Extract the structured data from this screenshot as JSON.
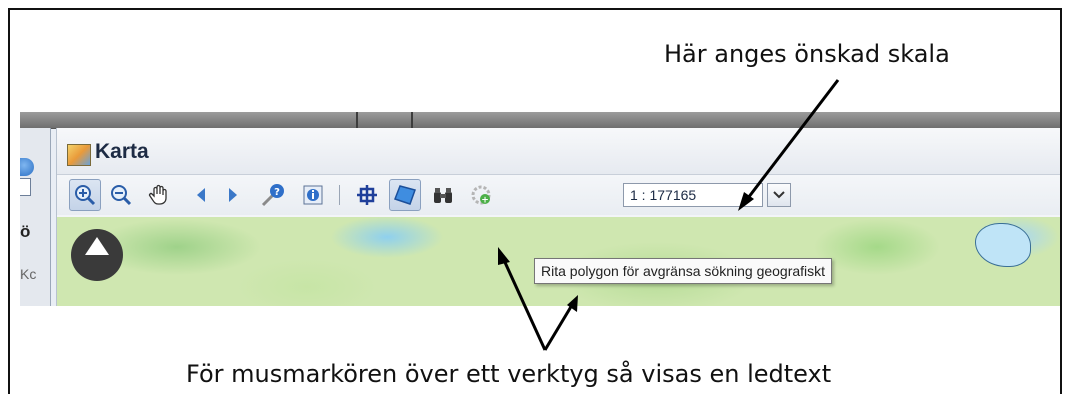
{
  "annotations": {
    "top_callout": "Här anges önskad skala",
    "bottom_callout": "För musmarkören över ett verktyg så visas en ledtext"
  },
  "panel": {
    "title": "Karta",
    "left_fragments": [
      "ö",
      "Kc"
    ]
  },
  "toolbar": {
    "tools": [
      {
        "icon": "zoom-in-icon",
        "pressed": true
      },
      {
        "icon": "zoom-out-icon",
        "pressed": false
      },
      {
        "icon": "pan-hand-icon",
        "pressed": false
      },
      {
        "icon": "previous-extent-icon",
        "pressed": false
      },
      {
        "icon": "next-extent-icon",
        "pressed": false
      },
      {
        "icon": "identify-icon",
        "pressed": false
      },
      {
        "icon": "info-icon",
        "pressed": false
      },
      {
        "icon": "select-extent-icon",
        "pressed": false
      },
      {
        "icon": "draw-polygon-icon",
        "pressed": true
      },
      {
        "icon": "binoculars-icon",
        "pressed": false
      },
      {
        "icon": "refresh-gear-icon",
        "pressed": false
      }
    ],
    "scale_value": "1 : 177165"
  },
  "tooltip": {
    "text": "Rita polygon för avgränsa sökning geografiskt"
  },
  "colors": {
    "accent_blue": "#2f6fc9",
    "map_green": "#cfe7b0",
    "toolbar_bg": "#eef1f5"
  }
}
